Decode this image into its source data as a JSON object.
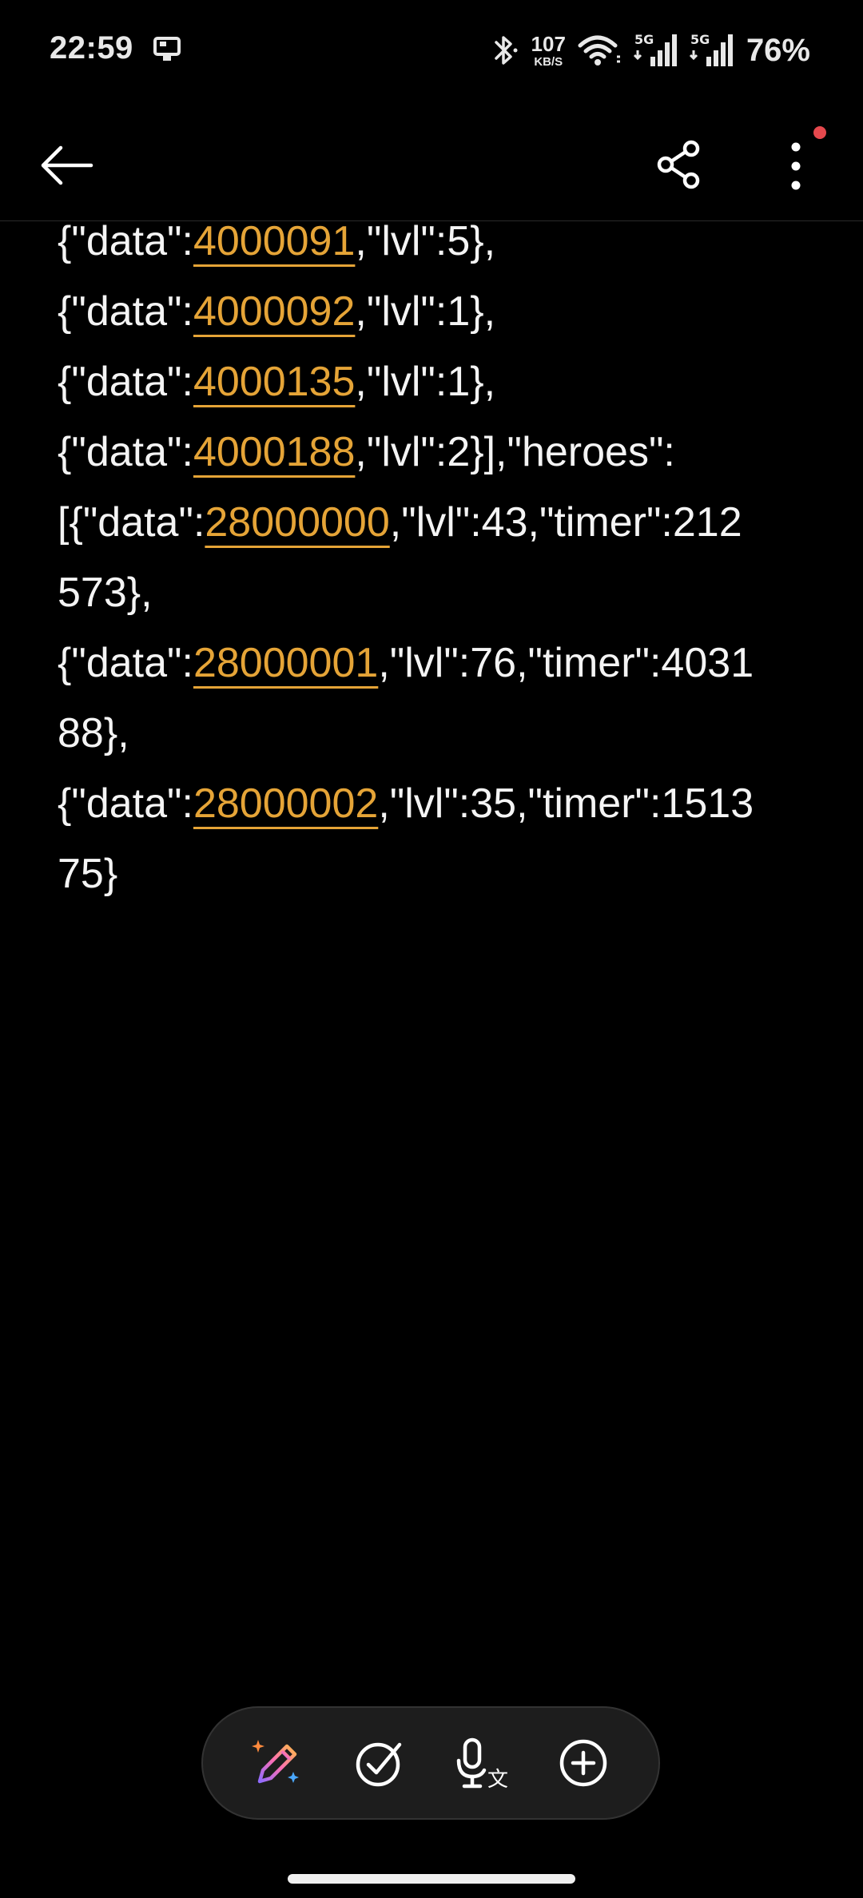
{
  "status_bar": {
    "time": "22:59",
    "net_speed_value": "107",
    "net_speed_unit": "KB/S",
    "battery": "76%",
    "icons": [
      "cast-icon",
      "bluetooth-icon",
      "wifi-icon",
      "signal-5g-icon",
      "signal-5g-icon-2"
    ]
  },
  "app_bar": {
    "icons": [
      "back-arrow-icon",
      "share-icon",
      "more-vertical-icon"
    ],
    "notification_dot_color": "#e5484d"
  },
  "colors": {
    "background": "#000000",
    "text": "#f4f4f4",
    "link": "#e5a437",
    "toolbar_bg": "#1d1d1d"
  },
  "note": {
    "lines": [
      {
        "pre": "{\"data\":",
        "link": "4000091",
        "post": ",\"lvl\":5},"
      },
      {
        "pre": "{\"data\":",
        "link": "4000092",
        "post": ",\"lvl\":1},"
      },
      {
        "pre": "{\"data\":",
        "link": "4000135",
        "post": ",\"lvl\":1},"
      },
      {
        "pre": "{\"data\":",
        "link": "4000188",
        "post": ",\"lvl\":2}],\"heroes\":"
      },
      {
        "pre": "[{\"data\":",
        "link": "28000000",
        "post": ",\"lvl\":43,\"timer\":212"
      },
      {
        "pre": "573},",
        "link": "",
        "post": ""
      },
      {
        "pre": "{\"data\":",
        "link": "28000001",
        "post": ",\"lvl\":76,\"timer\":4031"
      },
      {
        "pre": "88},",
        "link": "",
        "post": ""
      },
      {
        "pre": "{\"data\":",
        "link": "28000002",
        "post": ",\"lvl\":35,\"timer\":1513"
      },
      {
        "pre": "75}",
        "link": "",
        "post": ""
      }
    ]
  },
  "toolbar": {
    "icons": [
      "ai-pen-icon",
      "checkbox-icon",
      "voice-translate-icon",
      "add-circle-icon"
    ]
  }
}
